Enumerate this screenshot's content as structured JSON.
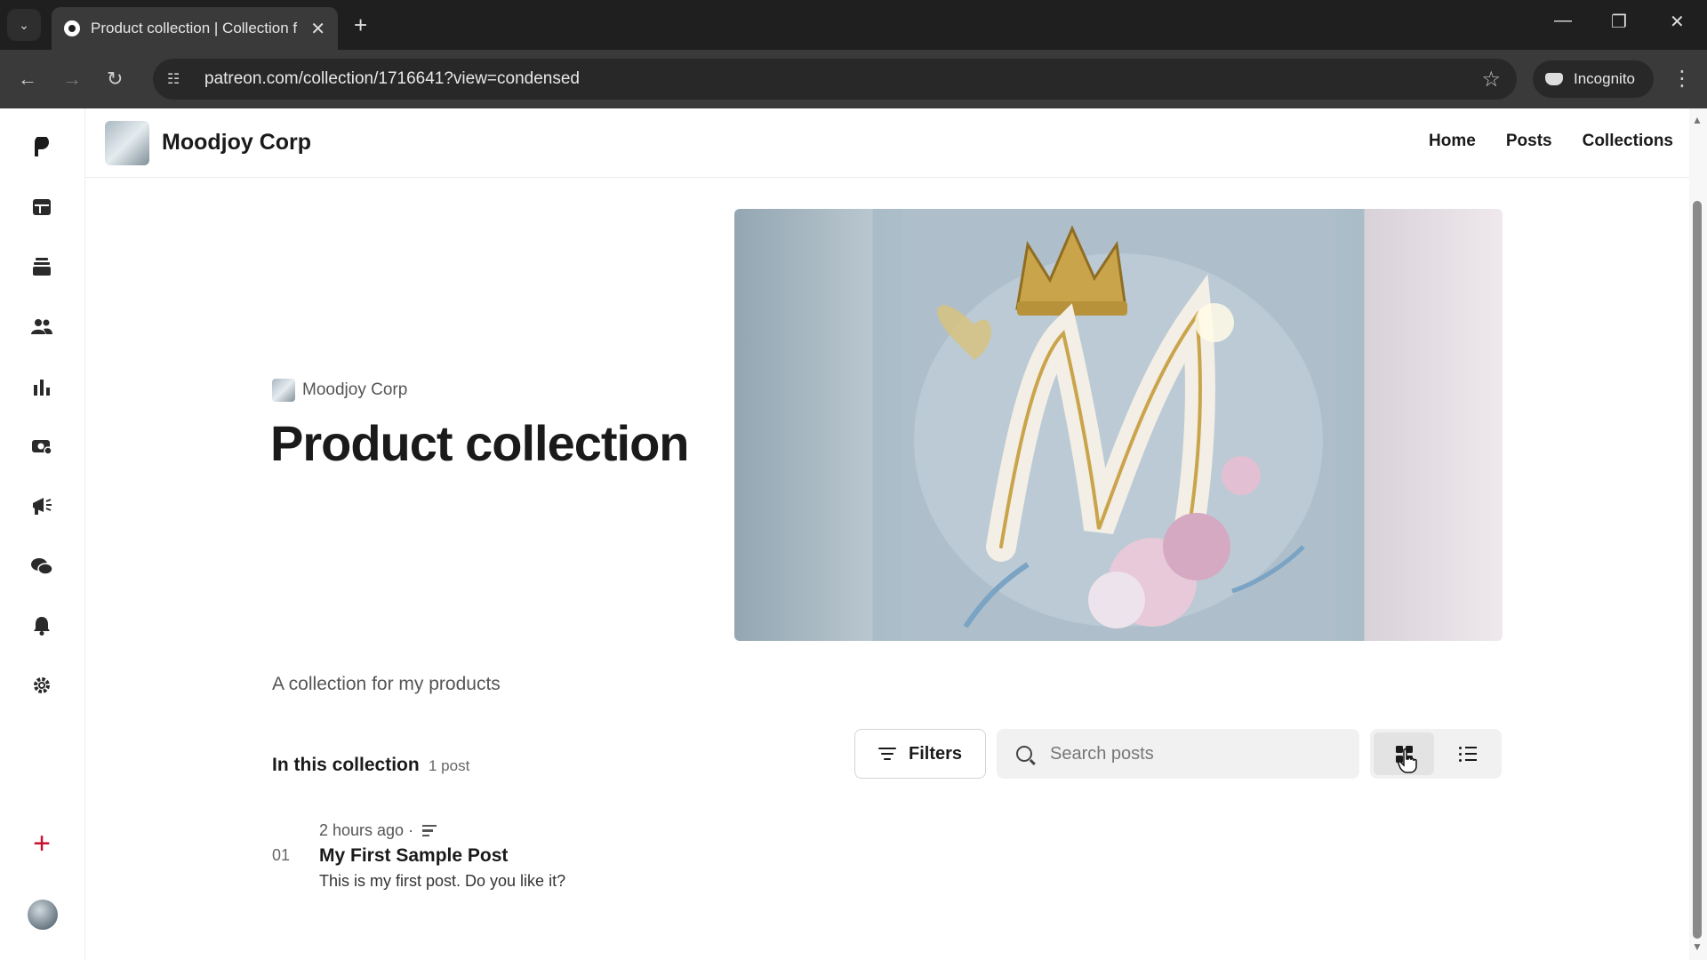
{
  "browser": {
    "tab_title": "Product collection | Collection f",
    "url": "patreon.com/collection/1716641?view=condensed",
    "incognito_label": "Incognito"
  },
  "header": {
    "creator_name": "Moodjoy Corp",
    "nav": [
      {
        "label": "Home"
      },
      {
        "label": "Posts"
      },
      {
        "label": "Collections"
      }
    ]
  },
  "sidebar": {
    "icons": [
      "patreon-logo-icon",
      "dashboard-icon",
      "library-icon",
      "audience-icon",
      "insights-icon",
      "payouts-icon",
      "promotions-icon",
      "chats-icon",
      "notifications-icon",
      "settings-icon"
    ]
  },
  "collection": {
    "creator": "Moodjoy Corp",
    "title": "Product collection",
    "description": "A collection for my products",
    "section_heading": "In this collection",
    "post_count": "1 post"
  },
  "toolbar": {
    "filters_label": "Filters",
    "search_placeholder": "Search posts",
    "search_value": ""
  },
  "posts": [
    {
      "index": "01",
      "meta": "2 hours ago ·",
      "title": "My First Sample Post",
      "excerpt": "This is my first post. Do you like it?"
    }
  ],
  "colors": {
    "accent_add": "#c8102e",
    "chrome_bg": "#1f1f1f"
  }
}
